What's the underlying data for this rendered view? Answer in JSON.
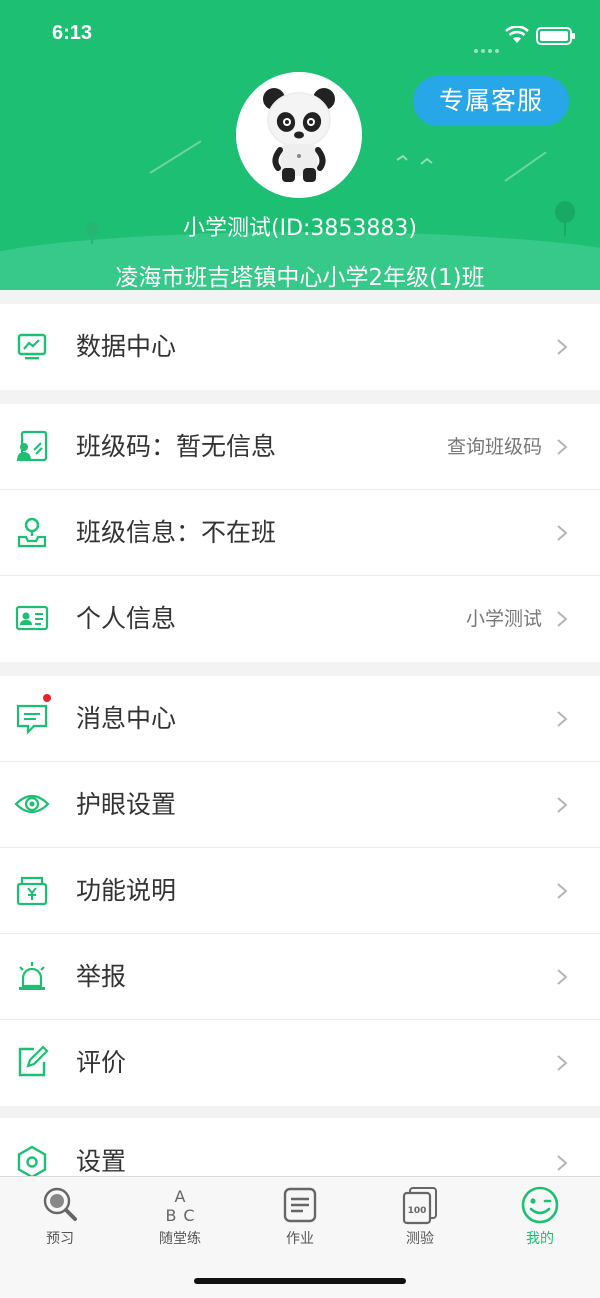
{
  "status_bar": {
    "time": "6:13"
  },
  "header": {
    "service_button": "专属客服",
    "user_line": "小学测试(ID:3853883)",
    "school_line": "凌海市班吉塔镇中心小学2年级(1)班"
  },
  "menu": {
    "data_center": {
      "label": "数据中心",
      "icon": "chart-monitor-icon"
    },
    "class_code": {
      "label": "班级码：暂无信息",
      "value": "查询班级码",
      "icon": "class-code-icon"
    },
    "class_info": {
      "label": "班级信息：不在班",
      "icon": "location-icon"
    },
    "personal_info": {
      "label": "个人信息",
      "value": "小学测试",
      "icon": "id-card-icon"
    },
    "messages": {
      "label": "消息中心",
      "icon": "message-icon",
      "has_unread_dot": true
    },
    "eye_care": {
      "label": "护眼设置",
      "icon": "eye-icon"
    },
    "features": {
      "label": "功能说明",
      "icon": "feature-box-icon"
    },
    "report": {
      "label": "举报",
      "icon": "alarm-icon"
    },
    "review": {
      "label": "评价",
      "icon": "edit-icon"
    },
    "settings": {
      "label": "设置",
      "icon": "settings-hexagon-icon"
    }
  },
  "tabbar": {
    "tabs": [
      {
        "label": "预习",
        "icon": "magnifier-icon"
      },
      {
        "label": "随堂练",
        "icon": "abc-icon"
      },
      {
        "label": "作业",
        "icon": "document-icon"
      },
      {
        "label": "测验",
        "icon": "test-100-icon"
      },
      {
        "label": "我的",
        "icon": "smiley-icon",
        "active": true
      }
    ]
  },
  "colors": {
    "brand_green": "#1dbf73",
    "service_blue": "#27a6e8",
    "unread_red": "#e8232d"
  }
}
